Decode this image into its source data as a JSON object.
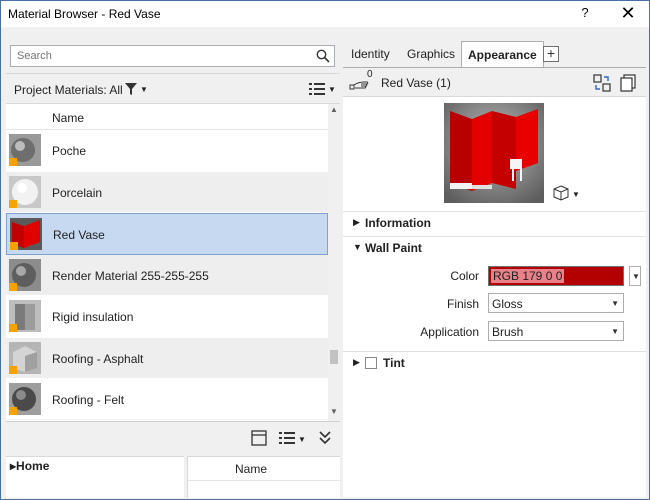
{
  "window": {
    "title": "Material Browser - Red Vase",
    "help_label": "?",
    "close_label": "✕"
  },
  "search": {
    "placeholder": "Search"
  },
  "filter": {
    "label": "Project Materials: All"
  },
  "list": {
    "column_header": "Name",
    "items": [
      {
        "name": "Poche",
        "selected": false
      },
      {
        "name": "Porcelain",
        "selected": false
      },
      {
        "name": "Red Vase",
        "selected": true
      },
      {
        "name": "Render Material 255-255-255",
        "selected": false
      },
      {
        "name": "Rigid insulation",
        "selected": false
      },
      {
        "name": "Roofing - Asphalt",
        "selected": false
      },
      {
        "name": "Roofing - Felt",
        "selected": false
      }
    ]
  },
  "library": {
    "home_label": "▸Home",
    "column_header": "Name"
  },
  "tabs": [
    {
      "label": "Identity",
      "active": false
    },
    {
      "label": "Graphics",
      "active": false
    },
    {
      "label": "Appearance",
      "active": true
    }
  ],
  "tab_add_label": "+",
  "asset": {
    "user_count": "0",
    "name": "Red Vase (1)"
  },
  "sections": {
    "information": "Information",
    "wall_paint": "Wall Paint",
    "tint": "Tint"
  },
  "properties": {
    "color_label": "Color",
    "color_value": "RGB 179 0 0",
    "finish_label": "Finish",
    "finish_value": "Gloss",
    "application_label": "Application",
    "application_value": "Brush"
  },
  "colors": {
    "selection": "#c6d9f0",
    "swatch": "#b30000"
  }
}
